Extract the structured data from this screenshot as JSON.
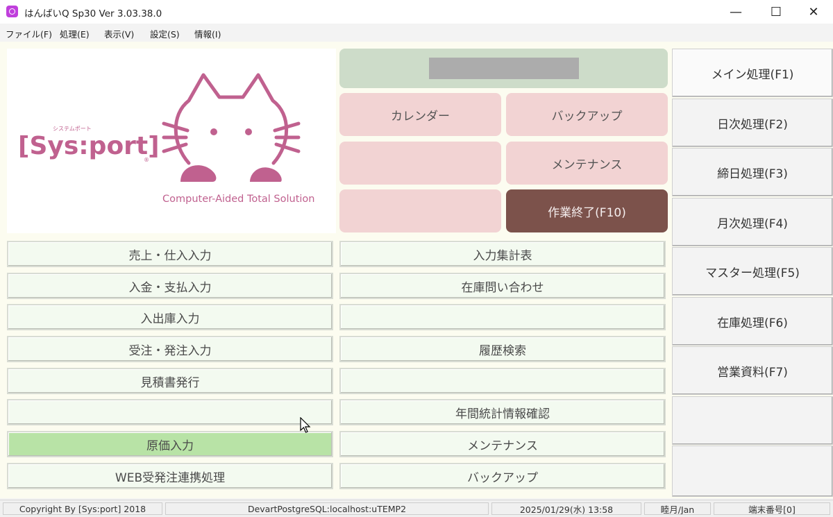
{
  "window": {
    "title": "はんばいQ Sp30 Ver 3.03.38.0",
    "minimize": "—",
    "maximize": "☐",
    "close": "✕"
  },
  "menu": [
    "ファイル(F)",
    "処理(E)",
    "表示(V)",
    "設定(S)",
    "情報(I)"
  ],
  "logo": {
    "brand": "[Sys:port]",
    "kana": "システムポート",
    "registered": "®",
    "tagline": "Computer-Aided Total Solution"
  },
  "top_buttons": {
    "calendar": "カレンダー",
    "backup": "バックアップ",
    "blank1": "",
    "maintenance": "メンテナンス",
    "blank2": "",
    "exit": "作業終了(F10)"
  },
  "left_buttons": [
    "売上・仕入入力",
    "入金・支払入力",
    "入出庫入力",
    "受注・発注入力",
    "見積書発行",
    "",
    "原価入力",
    "WEB受発注連携処理"
  ],
  "right_buttons": [
    "入力集計表",
    "在庫問い合わせ",
    "",
    "履歴検索",
    "",
    "年間統計情報確認",
    "メンテナンス",
    "バックアップ"
  ],
  "sidebar": [
    "メイン処理(F1)",
    "日次処理(F2)",
    "締日処理(F3)",
    "月次処理(F4)",
    "マスター処理(F5)",
    "在庫処理(F6)",
    "営業資料(F7)",
    "",
    ""
  ],
  "status": {
    "copyright": "Copyright By [Sys:port] 2018",
    "db": "DevartPostgreSQL:localhost:uTEMP2",
    "datetime": "2025/01/29(水) 13:58",
    "month": "睦月/Jan",
    "terminal": "端末番号[0]"
  },
  "colors": {
    "active_button": "#b8e3a6",
    "exit_button": "#7c524b",
    "logo_pink": "#c0618f"
  }
}
